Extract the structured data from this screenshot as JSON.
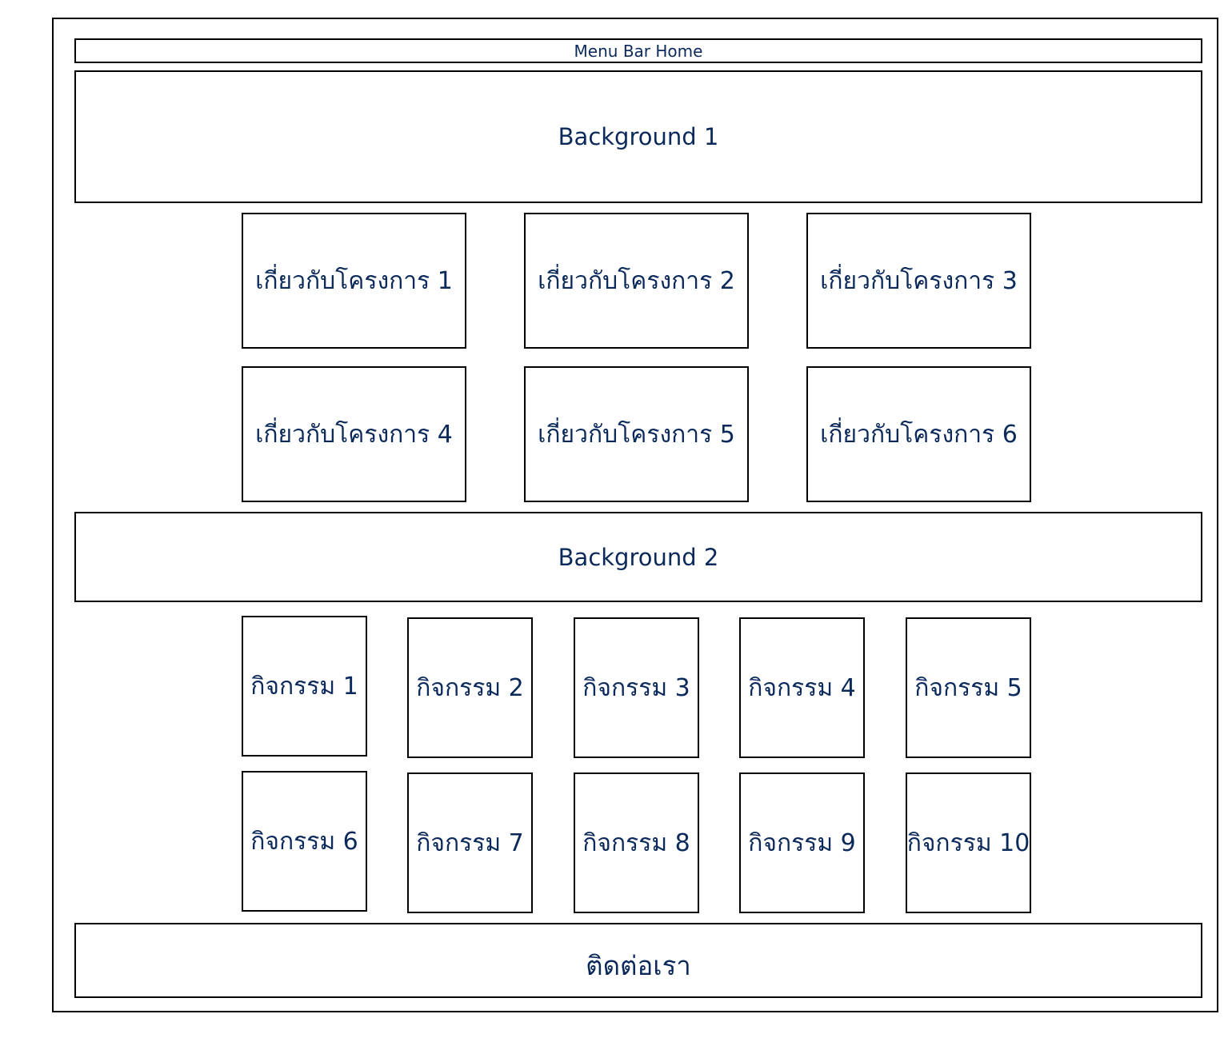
{
  "menu_bar": {
    "label": "Menu Bar Home"
  },
  "background_1": {
    "label": "Background 1"
  },
  "background_2": {
    "label": "Background 2"
  },
  "about_boxes": [
    {
      "label": "เกี่ยวกับโครงการ 1"
    },
    {
      "label": "เกี่ยวกับโครงการ 2"
    },
    {
      "label": "เกี่ยวกับโครงการ 3"
    },
    {
      "label": "เกี่ยวกับโครงการ 4"
    },
    {
      "label": "เกี่ยวกับโครงการ 5"
    },
    {
      "label": "เกี่ยวกับโครงการ 6"
    }
  ],
  "activity_boxes": [
    {
      "label": "กิจกรรม 1"
    },
    {
      "label": "กิจกรรม 2"
    },
    {
      "label": "กิจกรรม 3"
    },
    {
      "label": "กิจกรรม 4"
    },
    {
      "label": "กิจกรรม 5"
    },
    {
      "label": "กิจกรรม 6"
    },
    {
      "label": "กิจกรรม 7"
    },
    {
      "label": "กิจกรรม 8"
    },
    {
      "label": "กิจกรรม 9"
    },
    {
      "label": "กิจกรรม 10"
    }
  ],
  "contact": {
    "label": "ติดต่อเรา"
  },
  "colors": {
    "text": "#0b2a5b",
    "border": "#000000"
  }
}
